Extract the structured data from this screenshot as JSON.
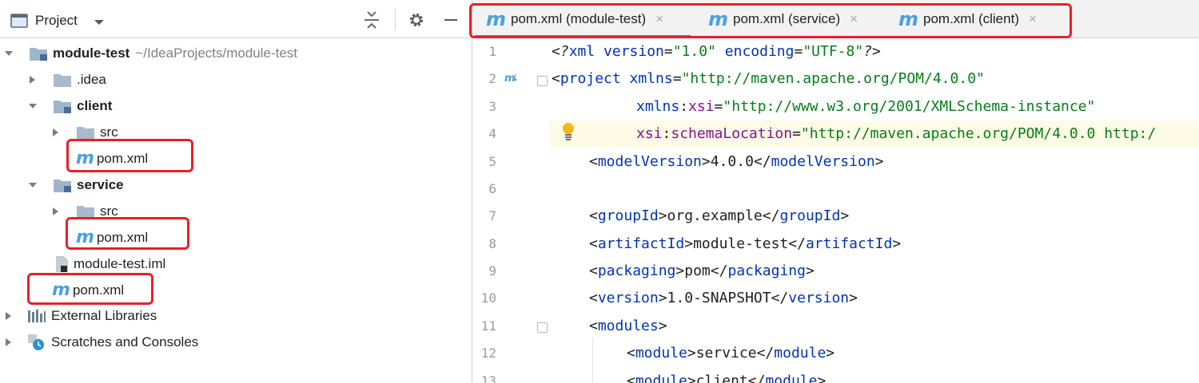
{
  "project_panel": {
    "title": "Project",
    "tree": [
      {
        "label": "module-test",
        "path": "~/IdeaProjects/module-test"
      },
      {
        "label": ".idea"
      },
      {
        "label": "client"
      },
      {
        "label": "src"
      },
      {
        "label": "pom.xml"
      },
      {
        "label": "service"
      },
      {
        "label": "src"
      },
      {
        "label": "pom.xml"
      },
      {
        "label": "module-test.iml"
      },
      {
        "label": "pom.xml"
      },
      {
        "label": "External Libraries"
      },
      {
        "label": "Scratches and Consoles"
      }
    ]
  },
  "tabs": [
    {
      "label": "pom.xml (module-test)",
      "active": true
    },
    {
      "label": "pom.xml (service)",
      "active": false
    },
    {
      "label": "pom.xml (client)",
      "active": false
    }
  ],
  "line_numbers": [
    "1",
    "2",
    "3",
    "4",
    "5",
    "6",
    "7",
    "8",
    "9",
    "10",
    "11",
    "12",
    "13"
  ],
  "code": {
    "l1_pi_open": "<?",
    "l1_xml": "xml",
    "l1_attr1": " version",
    "l1_eq1": "=",
    "l1_val1": "\"1.0\"",
    "l1_attr2": " encoding",
    "l1_eq2": "=",
    "l1_val2": "\"UTF-8\"",
    "l1_pi_close": "?>",
    "l2_open": "<",
    "l2_tag": "project",
    "l2_attr": " xmlns",
    "l2_eq": "=",
    "l2_val": "\"http://maven.apache.org/POM/4.0.0\"",
    "l3_ns": "xmlns",
    "l3_colon": ":",
    "l3_attr": "xsi",
    "l3_eq": "=",
    "l3_val": "\"http://www.w3.org/2001/XMLSchema-instance\"",
    "l4_ns": "xsi",
    "l4_colon": ":",
    "l4_attr": "schemaLocation",
    "l4_eq": "=",
    "l4_val": "\"http://maven.apache.org/POM/4.0.0 http:/",
    "l5": {
      "open": "<",
      "tag": "modelVersion",
      "close": ">",
      "text": "4.0.0",
      "end_open": "</",
      "end_tag": "modelVersion",
      "end_close": ">"
    },
    "l7": {
      "open": "<",
      "tag": "groupId",
      "close": ">",
      "text": "org.example",
      "end_open": "</",
      "end_tag": "groupId",
      "end_close": ">"
    },
    "l8": {
      "open": "<",
      "tag": "artifactId",
      "close": ">",
      "text": "module-test",
      "end_open": "</",
      "end_tag": "artifactId",
      "end_close": ">"
    },
    "l9": {
      "open": "<",
      "tag": "packaging",
      "close": ">",
      "text": "pom",
      "end_open": "</",
      "end_tag": "packaging",
      "end_close": ">"
    },
    "l10": {
      "open": "<",
      "tag": "version",
      "close": ">",
      "text": "1.0-SNAPSHOT",
      "end_open": "</",
      "end_tag": "version",
      "end_close": ">"
    },
    "l11": {
      "open": "<",
      "tag": "modules",
      "close": ">"
    },
    "l12": {
      "open": "<",
      "tag": "module",
      "close": ">",
      "text": "service",
      "end_open": "</",
      "end_tag": "module",
      "end_close": ">"
    },
    "l13": {
      "open": "<",
      "tag": "module",
      "close": ">",
      "text": "client",
      "end_open": "</",
      "end_tag": "module",
      "end_close": ">"
    }
  },
  "colors": {
    "highlight": "#e8202a",
    "maven_icon": "#4a9fe0",
    "tag": "#0033b3",
    "value": "#067d17",
    "namespace": "#871094"
  },
  "icons": [
    "project-view-icon",
    "dropdown-icon",
    "collapse-all-icon",
    "gear-icon",
    "hide-icon",
    "folder-icon",
    "module-folder-icon",
    "maven-icon",
    "iml-file-icon",
    "libraries-icon",
    "scratches-icon",
    "close-icon",
    "bulb-icon",
    "fold-icon"
  ]
}
